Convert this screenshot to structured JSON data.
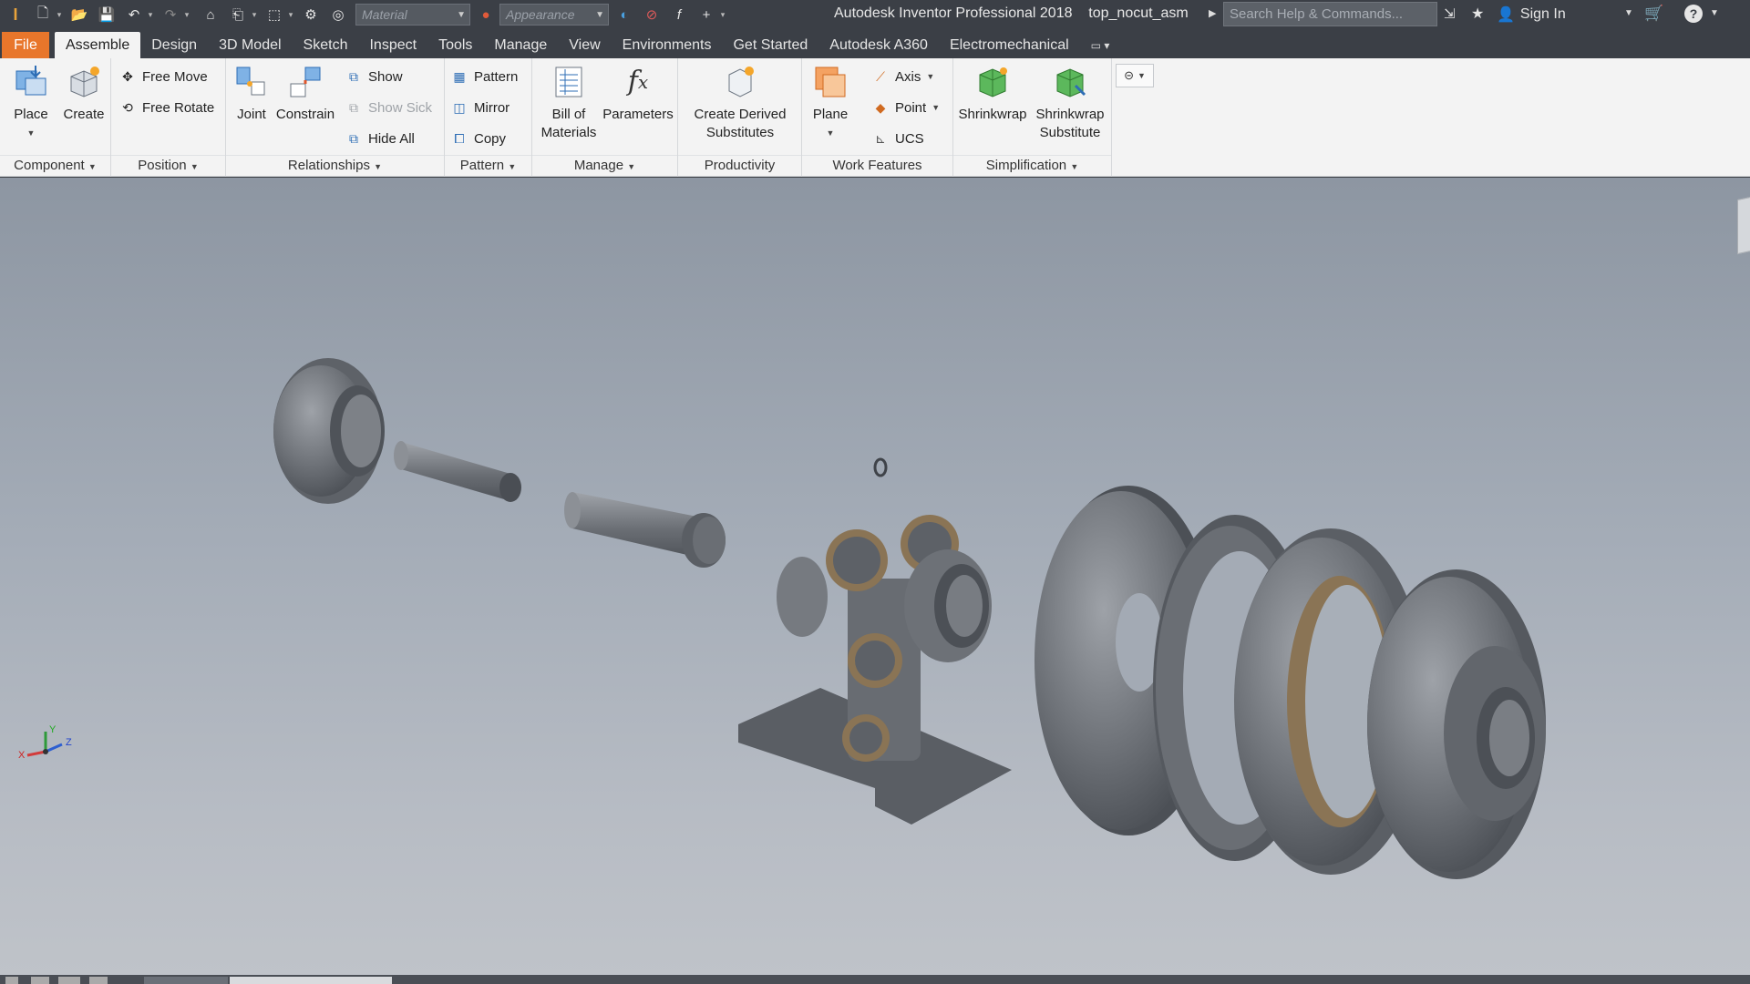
{
  "titlebar": {
    "material_placeholder": "Material",
    "appearance_placeholder": "Appearance",
    "app_name": "Autodesk Inventor Professional 2018",
    "document": "top_nocut_asm",
    "search_placeholder": "Search Help & Commands...",
    "sign_in": "Sign In",
    "icons": [
      "new-icon",
      "open-icon",
      "save-icon",
      "undo-icon",
      "redo-icon",
      "home-icon",
      "return-icon",
      "select-icon",
      "material-icon",
      "appearance-icon",
      "adjust-icon",
      "clear-icon",
      "function-icon",
      "add-icon",
      "cart-icon",
      "help-icon"
    ]
  },
  "tabs": [
    "File",
    "Assemble",
    "Design",
    "3D Model",
    "Sketch",
    "Inspect",
    "Tools",
    "Manage",
    "View",
    "Environments",
    "Get Started",
    "Autodesk A360",
    "Electromechanical"
  ],
  "active_tab": "Assemble",
  "ribbon": {
    "component": {
      "label": "Component",
      "place": "Place",
      "create": "Create"
    },
    "position": {
      "label": "Position",
      "free_move": "Free Move",
      "free_rotate": "Free Rotate"
    },
    "relationships": {
      "label": "Relationships",
      "joint": "Joint",
      "constrain": "Constrain",
      "show": "Show",
      "show_sick": "Show Sick",
      "hide_all": "Hide All"
    },
    "pattern": {
      "label": "Pattern",
      "pattern": "Pattern",
      "mirror": "Mirror",
      "copy": "Copy"
    },
    "manage": {
      "label": "Manage",
      "bom_line1": "Bill of",
      "bom_line2": "Materials",
      "parameters": "Parameters"
    },
    "productivity": {
      "label": "Productivity",
      "line1": "Create Derived",
      "line2": "Substitutes"
    },
    "work_features": {
      "label": "Work Features",
      "plane": "Plane",
      "axis": "Axis",
      "point": "Point",
      "ucs": "UCS"
    },
    "simplification": {
      "label": "Simplification",
      "shrinkwrap": "Shrinkwrap",
      "substitute_line1": "Shrinkwrap",
      "substitute_line2": "Substitute"
    }
  },
  "viewcube": {
    "x": "X",
    "y": "Y",
    "z": "Z"
  },
  "colors": {
    "accent": "#e8762b",
    "titlebar": "#3b3f46",
    "ribbon": "#f3f3f3"
  }
}
